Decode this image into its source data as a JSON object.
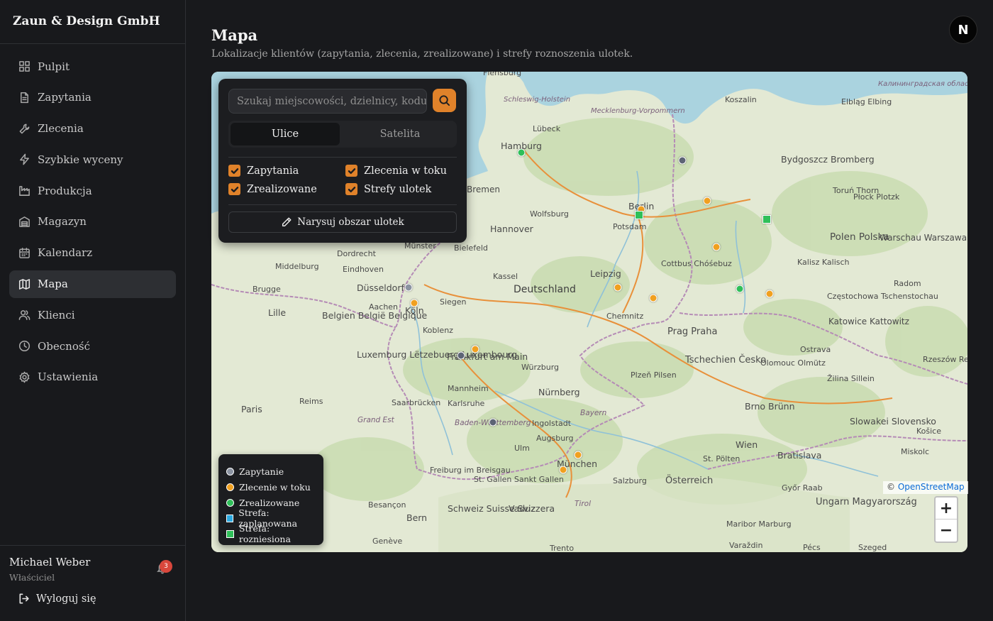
{
  "brand": "Zaun & Design GmbH",
  "nav": [
    {
      "label": "Pulpit",
      "icon": "dashboard-icon"
    },
    {
      "label": "Zapytania",
      "icon": "document-icon"
    },
    {
      "label": "Zlecenia",
      "icon": "wrench-icon"
    },
    {
      "label": "Szybkie wyceny",
      "icon": "lightning-icon"
    },
    {
      "label": "Produkcja",
      "icon": "factory-icon"
    },
    {
      "label": "Magazyn",
      "icon": "warehouse-icon"
    },
    {
      "label": "Kalendarz",
      "icon": "calendar-icon"
    },
    {
      "label": "Mapa",
      "icon": "map-icon",
      "active": true
    },
    {
      "label": "Klienci",
      "icon": "users-icon"
    },
    {
      "label": "Obecność",
      "icon": "clock-icon"
    },
    {
      "label": "Ustawienia",
      "icon": "gear-icon"
    }
  ],
  "user": {
    "name": "Michael Weber",
    "role": "Właściciel",
    "notifications": "3",
    "logout_label": "Wyloguj się"
  },
  "header": {
    "title": "Mapa",
    "subtitle": "Lokalizacje klientów (zapytania, zlecenia, zrealizowane) i strefy roznoszenia ulotek.",
    "avatar_letter": "N"
  },
  "panel": {
    "search_placeholder": "Szukaj miejscowości, dzielnicy, kodu…",
    "tabs": [
      "Ulice",
      "Satelita"
    ],
    "active_tab": "Ulice",
    "filters": [
      {
        "label": "Zapytania",
        "checked": true
      },
      {
        "label": "Zlecenia w toku",
        "checked": true
      },
      {
        "label": "Zrealizowane",
        "checked": true
      },
      {
        "label": "Strefy ulotek",
        "checked": true
      }
    ],
    "draw_label": "Narysuj obszar ulotek"
  },
  "legend": [
    {
      "label": "Zapytanie",
      "color": "#8b93a1",
      "shape": "dot"
    },
    {
      "label": "Zlecenie w toku",
      "color": "#f0a020",
      "shape": "dot"
    },
    {
      "label": "Zrealizowane",
      "color": "#2fbf59",
      "shape": "dot"
    },
    {
      "label": "Strefa: zaplanowana",
      "color": "#2ba9e0",
      "shape": "square"
    },
    {
      "label": "Strefa: rozniesiona",
      "color": "#2fbf59",
      "shape": "square"
    }
  ],
  "map": {
    "attribution_prefix": "©",
    "attribution_link": "OpenStreetMap",
    "zoom_in": "+",
    "zoom_out": "−",
    "colors": {
      "inquiry": "#5d6475",
      "in_progress": "#f0a020",
      "done": "#2fbf59",
      "zone_done": "#2fbf59",
      "zone_planned": "#2ba9e0"
    },
    "labels": {
      "flensburg": "Flensburg",
      "schleswig_holstein": "Schleswig-Holstein",
      "mecklenburg": "Mecklenburg-Vorpommern",
      "koszalin": "Koszalin",
      "elblag": "Elbląg Elbing",
      "kaliningrad": "Калининградская область",
      "hamburg": "Hamburg",
      "lubeck": "Lübeck",
      "bremen": "Bremen",
      "hannover": "Hannover",
      "wolfsburg": "Wolfsburg",
      "berlin": "Berlin",
      "potsdam": "Potsdam",
      "bydgoszcz": "Bydgoszcz Bromberg",
      "torun": "Toruń Thorn",
      "plock": "Płock Plotzk",
      "warszawa": "Warschau Warszawa",
      "polen": "Polen Polska",
      "leipzig": "Leipzig",
      "cottbus": "Cottbus Chóśebuz",
      "kalisz": "Kalisz Kalisch",
      "radom": "Radom",
      "middelburg": "Middelburg",
      "dordrecht": "Dordrecht",
      "eindhoven": "Eindhoven",
      "dusseldorf": "Düsseldorf",
      "munster": "Münster",
      "bielefeld": "Bielefeld",
      "kassel": "Kassel",
      "deutschland": "Deutschland",
      "brugge": "Brugge",
      "lille": "Lille",
      "belgien": "Belgien België Belgique",
      "aachen": "Aachen",
      "koln": "Köln",
      "siegen": "Siegen",
      "koblenz": "Koblenz",
      "chemnitz": "Chemnitz",
      "czestochowa": "Częstochowa Tschenstochau",
      "katowice": "Katowice Kattowitz",
      "prag": "Prag Praha",
      "frankfurt": "Frankfurt am Main",
      "luxemburg": "Luxemburg Lëtzebuerg Luxembourg",
      "wurzburg": "Würzburg",
      "tschechien": "Tschechien Česko",
      "olomouc": "Olomouc Olmütz",
      "ostrava": "Ostrava",
      "rzeszow": "Rzeszów Resche",
      "zilina": "Žilina Sillein",
      "mannheim": "Mannheim",
      "karlsruhe": "Karlsruhe",
      "nurnberg": "Nürnberg",
      "plzen": "Plzeň Pilsen",
      "saarbrucken": "Saarbrücken",
      "reims": "Reims",
      "paris": "Paris",
      "grand_est": "Grand Est",
      "baden_wurttemberg": "Baden-Württemberg",
      "ingolstadt": "Ingolstadt",
      "bayern": "Bayern",
      "brno": "Brno Brünn",
      "slowakei": "Slowakei Slovensko",
      "kosice": "Košice",
      "augsburg": "Augsburg",
      "ulm": "Ulm",
      "munchen": "München",
      "wien": "Wien",
      "bratislava": "Bratislava",
      "st_polten": "St. Pölten",
      "miskolc": "Miskolc",
      "freiburg": "Freiburg im Breisgau",
      "sankt_gallen": "St. Gallen Sankt Gallen",
      "salzburg": "Salzburg",
      "osterreich": "Österreich",
      "gyor": "Győr Raab",
      "ungarn": "Ungarn Magyarország",
      "besancon": "Besançon",
      "schweiz": "Schweiz Suisse Svizzera",
      "vaduz": "Vaduz",
      "bern": "Bern",
      "tirol": "Tirol",
      "maribor": "Maribor Marburg",
      "trento": "Trento",
      "varazdin": "Varaždin",
      "pecs": "Pécs",
      "szeged": "Szeged",
      "geneve": "Genève"
    }
  }
}
